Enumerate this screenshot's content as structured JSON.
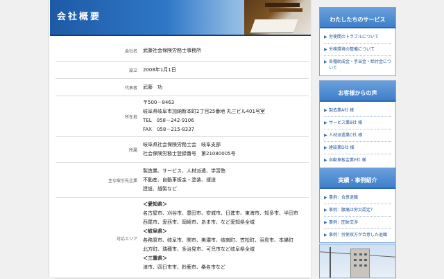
{
  "header": {
    "title": "会社概要"
  },
  "company_info": [
    {
      "label": "会社名",
      "lines": [
        "武藤社会保険労務士事務所"
      ]
    },
    {
      "label": "設立",
      "lines": [
        "2008年1月1日"
      ]
    },
    {
      "label": "代表者",
      "lines": [
        "武藤　功"
      ]
    },
    {
      "label": "所在地",
      "lines": [
        "〒500－8463",
        "岐阜県岐阜市加納新本町2丁目25番地 丸三ビル401号室",
        "TEL　058－242-9106",
        "FAX　058－215-8337"
      ]
    },
    {
      "label": "所属",
      "lines": [
        "岐阜県社会保険労務士会　岐阜支部",
        "社会保険労務士登録番号　第21080005号"
      ]
    },
    {
      "label": "主な取引先企業",
      "lines": [
        "製造業、サービス、人材派遣、学習塾",
        "不動産、自動車板金・塗装、運送",
        "建設、縫製など"
      ]
    },
    {
      "label": "対応エリア",
      "lines": [
        "＜愛知県＞",
        "名古屋市、刈谷市、豊田市、安城市、日進市、東海市、知多市、半田市",
        "西尾市、愛西市、岡崎市、あま市、など愛知県全域",
        "＜岐阜県＞",
        "各務原市、岐阜市、関市、美濃市、岐南町、笠松町、羽島市、本巣町",
        "北方町、瑞穂市、多治見市、可児市など岐阜県全域",
        "＜三重県＞",
        "津市、四日市市、鈴鹿市、桑名市など"
      ]
    }
  ],
  "sidebar": {
    "services": {
      "heading": "わたしたちのサービス",
      "items": [
        "労使間のトラブルについて",
        "労務環境の整備について",
        "各種助成金・手当金・給付金について"
      ]
    },
    "testimonials": {
      "heading": "お客様からの声",
      "items": [
        "製造業A社 様",
        "サービス業B社 様",
        "人材派遣業C社 様",
        "建設業D社 様",
        "自動車板金業E社 様"
      ]
    },
    "cases": {
      "heading": "実績・事例紹介",
      "items": [
        "事例：合意退職",
        "事例：腰痛は労災認定？",
        "事例：団体交渉",
        "事例：労使双方が合意した退職"
      ]
    }
  }
}
